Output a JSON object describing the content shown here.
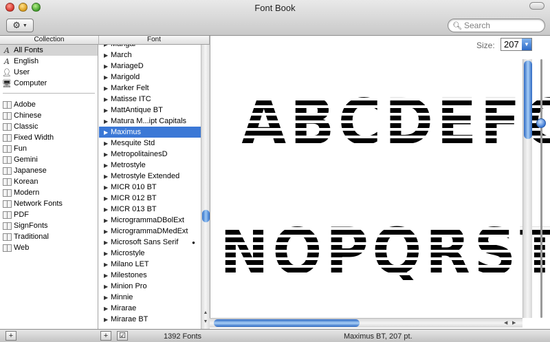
{
  "window": {
    "title": "Font Book"
  },
  "toolbar": {
    "action_icon": "gear-icon",
    "search_placeholder": "Search"
  },
  "columns": {
    "collection_header": "Collection",
    "font_header": "Font"
  },
  "collections": {
    "top": [
      {
        "label": "All Fonts",
        "icon": "font-A-icon",
        "selected": true
      },
      {
        "label": "English",
        "icon": "font-A-icon"
      },
      {
        "label": "User",
        "icon": "user-icon"
      },
      {
        "label": "Computer",
        "icon": "computer-icon"
      }
    ],
    "groups": [
      {
        "label": "Adobe"
      },
      {
        "label": "Chinese"
      },
      {
        "label": "Classic"
      },
      {
        "label": "Fixed Width"
      },
      {
        "label": "Fun"
      },
      {
        "label": "Gemini"
      },
      {
        "label": "Japanese"
      },
      {
        "label": "Korean"
      },
      {
        "label": "Modern"
      },
      {
        "label": "Network Fonts"
      },
      {
        "label": "PDF"
      },
      {
        "label": "SignFonts"
      },
      {
        "label": "Traditional"
      },
      {
        "label": "Web"
      }
    ]
  },
  "fonts": [
    "Mangal",
    "March",
    "MariageD",
    "Marigold",
    "Marker Felt",
    "Matisse ITC",
    "MattAntique BT",
    "Matura M...ipt Capitals",
    "Maximus",
    "Mesquite Std",
    "MetropolitainesD",
    "Metrostyle",
    "Metrostyle Extended",
    "MICR 010 BT",
    "MICR 012 BT",
    "MICR 013 BT",
    "MicrogrammaDBolExt",
    "MicrogrammaDMedExt",
    "Microsoft Sans Serif",
    "Microstyle",
    "Milano LET",
    "Milestones",
    "Minion Pro",
    "Minnie",
    "Mirarae",
    "Mirarae BT"
  ],
  "selected_font": "Maximus",
  "dotted_font": "Microsoft Sans Serif",
  "preview": {
    "size_label": "Size:",
    "size_value": "207",
    "line1": "ABCDEFG",
    "line2": "NOPQRST"
  },
  "status": {
    "font_count": "1392 Fonts",
    "current_font": "Maximus BT, 207 pt."
  },
  "bottom_buttons": {
    "add_left": "+",
    "add_mid": "+",
    "check": "☑"
  }
}
